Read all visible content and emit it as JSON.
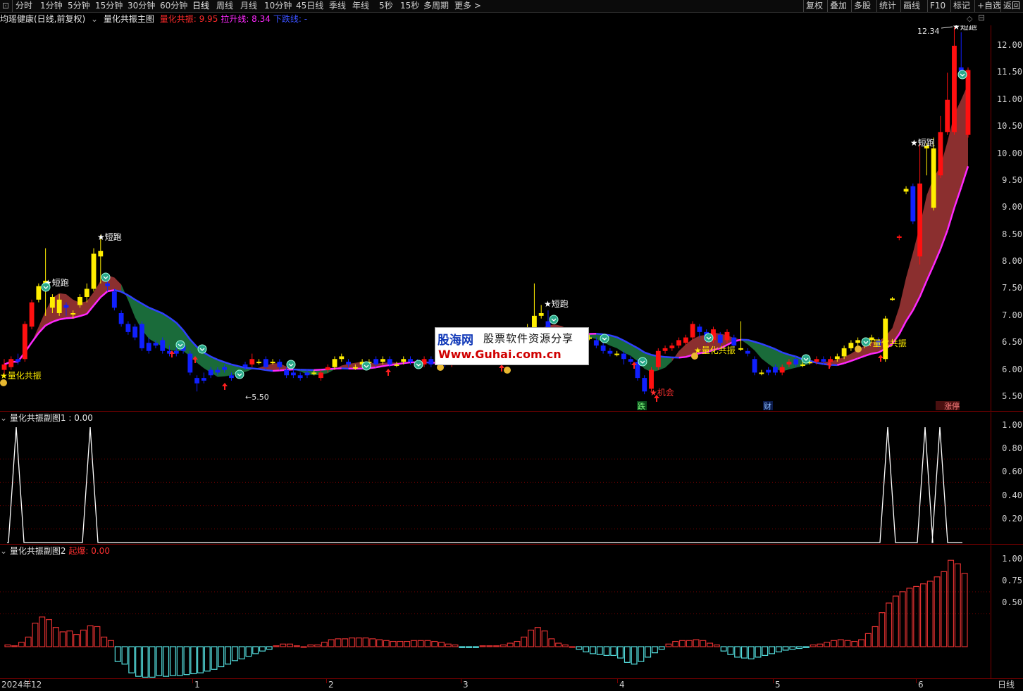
{
  "toolbar": {
    "left_items": [
      "分时",
      "1分钟",
      "5分钟",
      "15分钟",
      "30分钟",
      "60分钟",
      "日线",
      "周线",
      "月线",
      "10分钟",
      "45日线",
      "季线",
      "年线",
      "5秒",
      "15秒",
      "多周期",
      "更多 >"
    ],
    "active": "日线",
    "right_items": [
      "复权",
      "叠加",
      "多股",
      "统计",
      "画线",
      "F10",
      "标记",
      "+自选",
      "返回"
    ]
  },
  "main_panel": {
    "stock_label": "均瑶健康(日线,前复权)",
    "indicator_name": "量化共振主图",
    "lines": [
      {
        "name": "量化共振:",
        "value": "9.95",
        "color": "#ff2a2a"
      },
      {
        "name": "拉升线:",
        "value": "8.34",
        "color": "#ff28ff"
      },
      {
        "name": "下跌线:",
        "value": "-",
        "color": "#3a50ff"
      }
    ],
    "y_axis": [
      "12.00",
      "11.50",
      "11.00",
      "10.50",
      "10.00",
      "9.50",
      "9.00",
      "8.50",
      "8.00",
      "7.50",
      "7.00",
      "6.50",
      "6.00",
      "5.50"
    ],
    "annotations": {
      "high": "12.34",
      "low": "←5.50",
      "short_run": "★短跑",
      "resonance": "★量化共振",
      "chance": "★机会",
      "fall": "跌",
      "wealth": "财",
      "limit_up": "涨停"
    }
  },
  "sub1": {
    "title": "量化共振副图1",
    "value_label": ": 0.00",
    "y_axis": [
      "1.00",
      "0.80",
      "0.60",
      "0.40",
      "0.20"
    ]
  },
  "sub2": {
    "title": "量化共振副图2",
    "series_name": "起爆:",
    "value": "0.00",
    "y_axis": [
      "1.00",
      "0.75",
      "0.50"
    ]
  },
  "x_axis": {
    "dates": [
      "2024年",
      "12",
      "1",
      "2",
      "3",
      "4",
      "5",
      "6"
    ],
    "period": "日线"
  },
  "watermark": {
    "line1": "股海网",
    "line1b": "股票软件资源分享",
    "line2": "Www.Guhai.com.cn"
  },
  "colors": {
    "up": "#ff1010",
    "down": "#1020ff",
    "bright": "#ffee00",
    "ribbon_up": "#8b2f2f",
    "ribbon_down": "#1a6b3a",
    "pink": "#ff28ff",
    "blue": "#3040ff",
    "cyan": "#55e0e0",
    "sub2_red": "#e03030"
  }
}
